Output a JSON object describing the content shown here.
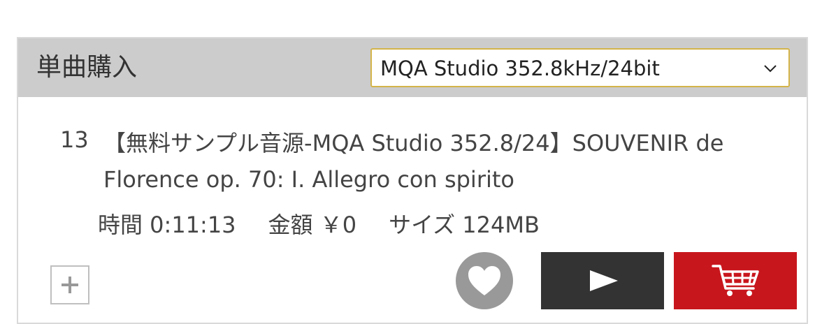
{
  "header": {
    "title": "単曲購入",
    "format_select": {
      "selected": "MQA Studio 352.8kHz/24bit"
    }
  },
  "track": {
    "number": "13",
    "title": "【無料サンプル音源-MQA Studio 352.8/24】SOUVENIR de Florence op. 70: I. Allegro con spirito",
    "duration": "時間 0:11:13",
    "price": "金額 ￥0",
    "size": "サイズ 124MB"
  },
  "icons": {
    "expand": "plus-icon",
    "favorite": "heart-icon",
    "play": "play-icon",
    "cart": "cart-icon",
    "dropdown": "chevron-down-icon"
  },
  "colors": {
    "header_bg": "#cccccc",
    "select_border": "#d4b44a",
    "favorite_bg": "#999999",
    "play_bg": "#333333",
    "cart_bg": "#c8161d"
  }
}
